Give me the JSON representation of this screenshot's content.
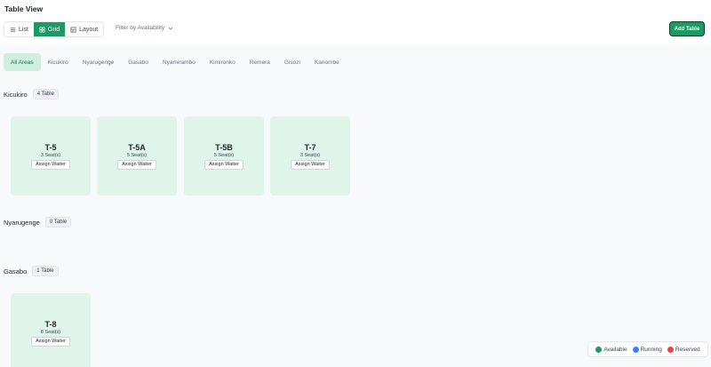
{
  "header": {
    "title": "Table View"
  },
  "views": [
    {
      "label": "List",
      "icon": "list-icon",
      "active": false
    },
    {
      "label": "Grid",
      "icon": "grid-icon",
      "active": true
    },
    {
      "label": "Layout",
      "icon": "layout-icon",
      "active": false
    }
  ],
  "filter": {
    "label": "Filter by Availability"
  },
  "actions": {
    "add_table": "Add Table"
  },
  "areas": [
    "All Areas",
    "Kicukiro",
    "Nyarugenge",
    "Gasabo",
    "Nyamirambo",
    "Kimironko",
    "Remera",
    "Gisozi",
    "Kanombe"
  ],
  "active_area": "All Areas",
  "sections": [
    {
      "name": "Kicukiro",
      "count": "4 Table",
      "tables": [
        {
          "name": "T-5",
          "seats": "3 Seat(s)",
          "action": "Assign Waiter"
        },
        {
          "name": "T-5A",
          "seats": "5 Seat(s)",
          "action": "Assign Waiter"
        },
        {
          "name": "T-5B",
          "seats": "5 Seat(s)",
          "action": "Assign Waiter"
        },
        {
          "name": "T-7",
          "seats": "3 Seat(s)",
          "action": "Assign Waiter"
        }
      ]
    },
    {
      "name": "Nyarugenge",
      "count": "0 Table",
      "tables": []
    },
    {
      "name": "Gasabo",
      "count": "1 Table",
      "tables": [
        {
          "name": "T-8",
          "seats": "8 Seat(s)",
          "action": "Assign Waiter"
        }
      ]
    }
  ],
  "legend": [
    {
      "label": "Available",
      "color": "#1b9a63"
    },
    {
      "label": "Running",
      "color": "#3b82f6"
    },
    {
      "label": "Reserved",
      "color": "#ef4444"
    }
  ],
  "colors": {
    "accent": "#1b9a63",
    "card_bg": "#dff5ea",
    "active_tab_bg": "#cfeee0"
  }
}
